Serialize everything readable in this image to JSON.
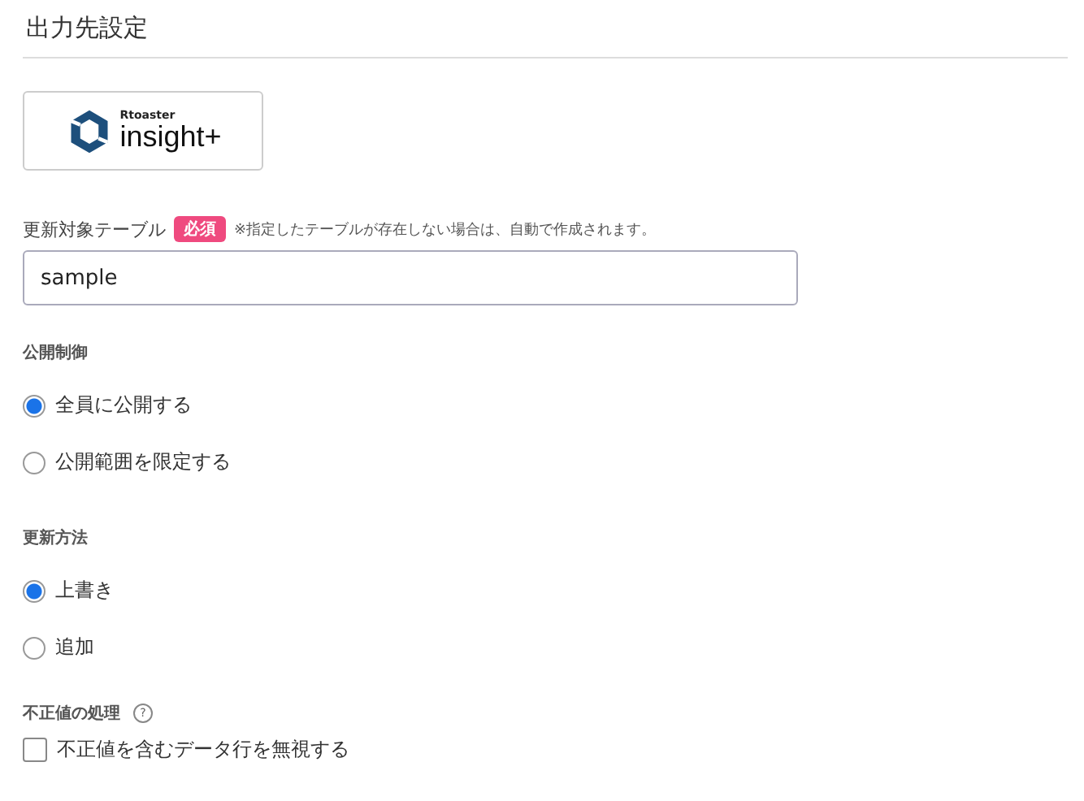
{
  "title": "出力先設定",
  "logo": {
    "brand": "Rtoaster",
    "product": "insight+"
  },
  "table_field": {
    "label": "更新対象テーブル",
    "badge": "必須",
    "note": "※指定したテーブルが存在しない場合は、自動で作成されます。",
    "value": "sample"
  },
  "visibility": {
    "label": "公開制御",
    "options": [
      {
        "label": "全員に公開する",
        "selected": true
      },
      {
        "label": "公開範囲を限定する",
        "selected": false
      }
    ]
  },
  "update_method": {
    "label": "更新方法",
    "options": [
      {
        "label": "上書き",
        "selected": true
      },
      {
        "label": "追加",
        "selected": false
      }
    ]
  },
  "invalid_values": {
    "label": "不正値の処理",
    "help": "?",
    "checkbox": {
      "label": "不正値を含むデータ行を無視する",
      "checked": false
    }
  }
}
